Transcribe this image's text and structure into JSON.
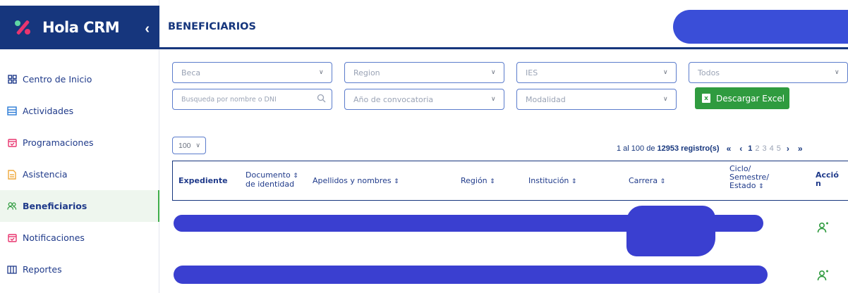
{
  "app": {
    "name": "Hola CRM",
    "collapse_glyph": "‹",
    "colors": {
      "primary": "#16367d",
      "accent_green": "#2f9b3f",
      "accent_pink": "#e8356f",
      "redaction": "#3a3fd0"
    }
  },
  "sidebar": {
    "items": [
      {
        "label": "Centro de Inicio",
        "icon": "grid-icon",
        "active": false
      },
      {
        "label": "Actividades",
        "icon": "list-icon",
        "active": false
      },
      {
        "label": "Programaciones",
        "icon": "calendar-icon",
        "active": false
      },
      {
        "label": "Asistencia",
        "icon": "document-icon",
        "active": false
      },
      {
        "label": "Beneficiarios",
        "icon": "users-icon",
        "active": true
      },
      {
        "label": "Notificaciones",
        "icon": "calendar-check-icon",
        "active": false
      },
      {
        "label": "Reportes",
        "icon": "table-icon",
        "active": false
      }
    ]
  },
  "header": {
    "title": "BENEFICIARIOS"
  },
  "filters": {
    "beca": "Beca",
    "region": "Region",
    "ies": "IES",
    "estado": "Todos",
    "search_placeholder": "Busqueda por nombre o DNI",
    "anio": "Año de convocatoria",
    "modalidad": "Modalidad",
    "export_label": "Descargar Excel"
  },
  "pagination": {
    "page_size": "100",
    "range": "1 al 100 de",
    "total": "12953",
    "suffix": "registro(s)",
    "first": "«",
    "prev": "‹",
    "pages": [
      "1",
      "2",
      "3",
      "4",
      "5"
    ],
    "current": "1",
    "next": "›",
    "last": "»"
  },
  "table": {
    "columns": {
      "expediente": "Expediente",
      "documento_1": "Documento",
      "documento_2": "de identidad",
      "apellidos": "Apellidos y nombres",
      "region": "Región",
      "institucion": "Institución",
      "carrera": "Carrera",
      "ciclo_1": "Ciclo/",
      "ciclo_2": "Semestre/",
      "ciclo_3": "Estado",
      "accion_1": "Acció",
      "accion_2": "n"
    },
    "sort_glyph": "⇕"
  }
}
